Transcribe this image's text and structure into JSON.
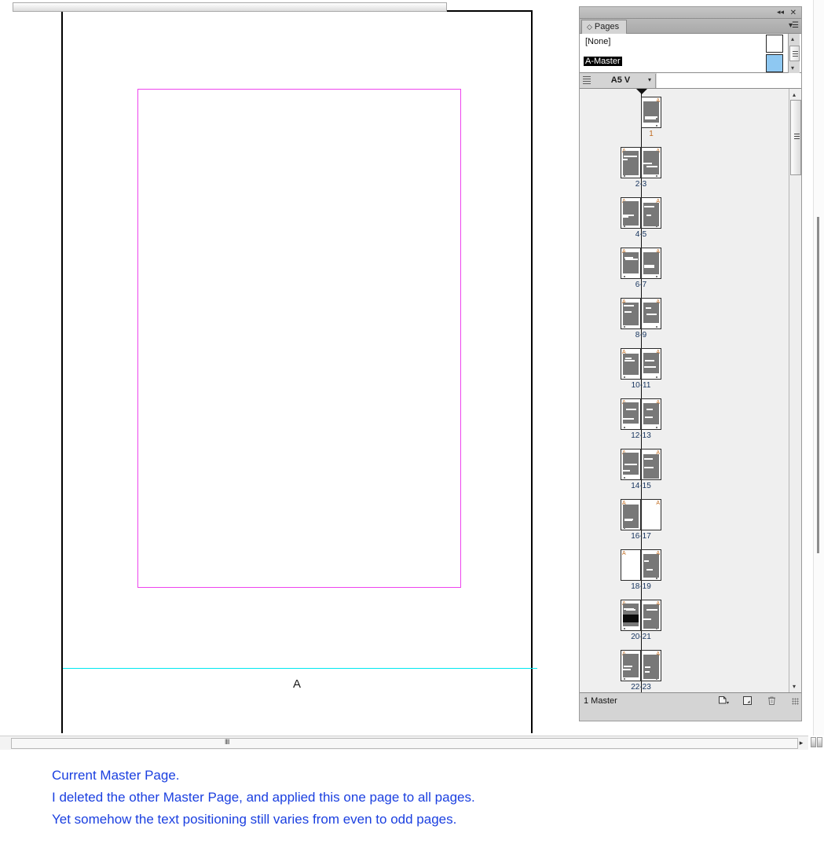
{
  "document": {
    "master_letter": "A",
    "guides": {
      "margin_color": "#ee44ee",
      "footer_color": "#00e8f0"
    }
  },
  "panel": {
    "title_tab": "Pages",
    "tab_icon": "double-arrow-icon",
    "collapse_icon": "◂◂",
    "close_icon": "✕",
    "menu_icon": "▾☰",
    "masters": [
      {
        "name": "[None]",
        "selected": false,
        "thumb": "white"
      },
      {
        "name": "A-Master",
        "selected": true,
        "thumb": "blue"
      }
    ],
    "size_control": {
      "grip_icon": "list-grip-icon",
      "value": "A5 V",
      "caret_icon": "▾"
    },
    "spreads": [
      {
        "label": "1",
        "current": true,
        "pages": [
          "right"
        ]
      },
      {
        "label": "2-3",
        "current": false,
        "pages": [
          "left",
          "right"
        ]
      },
      {
        "label": "4-5",
        "current": false,
        "pages": [
          "left",
          "right"
        ]
      },
      {
        "label": "6-7",
        "current": false,
        "pages": [
          "left",
          "right"
        ]
      },
      {
        "label": "8-9",
        "current": false,
        "pages": [
          "left",
          "right"
        ]
      },
      {
        "label": "10-11",
        "current": false,
        "pages": [
          "left",
          "right"
        ]
      },
      {
        "label": "12-13",
        "current": false,
        "pages": [
          "left",
          "right"
        ]
      },
      {
        "label": "14-15",
        "current": false,
        "pages": [
          "left",
          "right"
        ]
      },
      {
        "label": "16-17",
        "current": false,
        "pages": [
          "left",
          "right"
        ]
      },
      {
        "label": "18-19",
        "current": false,
        "pages": [
          "left",
          "right"
        ]
      },
      {
        "label": "20-21",
        "current": false,
        "pages": [
          "left",
          "right"
        ]
      },
      {
        "label": "22-23",
        "current": false,
        "pages": [
          "left",
          "right"
        ]
      }
    ],
    "page_master_mark": "A",
    "footer": {
      "status": "1 Master",
      "new_master_icon": "new-master-icon",
      "new_page_icon": "new-page-icon",
      "delete_icon": "🗑",
      "resize_grip_icon": "resize-grip-icon"
    }
  },
  "scrollbars": {
    "horizontal_grip": "‖‖",
    "right_arrow": "▸",
    "up_arrow": "▴",
    "down_arrow": "▾"
  },
  "caption": {
    "line1": "Current Master Page.",
    "line2": "I deleted the other Master Page, and applied this one page to all pages.",
    "line3": "Yet somehow the text positioning still varies from even to odd pages."
  }
}
